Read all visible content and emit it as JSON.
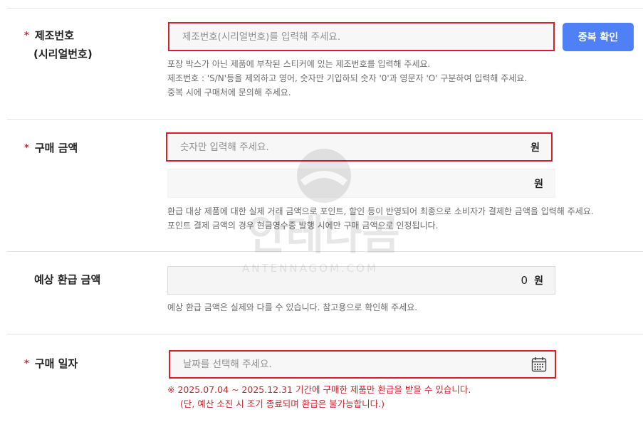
{
  "serial": {
    "label_line1": "제조번호",
    "label_line2": "(시리얼번호)",
    "placeholder": "제조번호(시리얼번호)를 입력해 주세요.",
    "check_button": "중복 확인",
    "help": [
      "포장 박스가 아닌 제품에 부착된 스티커에 있는 제조번호를 입력해 주세요.",
      "제조번호 : 'S/N'등을 제외하고 영어, 숫자만 기입하되 숫자 '0'과 영문자 'O' 구분하여 입력해 주세요.",
      "중복 시에 구매처에 문의해 주세요."
    ]
  },
  "purchase_amount": {
    "label": "구매 금액",
    "placeholder": "숫자만 입력해 주세요.",
    "unit": "원",
    "second_unit": "원",
    "help": [
      "환급 대상 제품에 대한 실제 거래 금액으로 포인트, 할인 등이 반영되어 최종으로 소비자가 결제한 금액을 입력해 주세요.",
      "포인트 결제 금액의 경우 현금영수증 발행 시에만 구매 금액으로 인정됩니다."
    ]
  },
  "expected_refund": {
    "label": "예상 환급 금액",
    "value": "0",
    "unit": "원",
    "help": "예상 환급 금액은 실제와 다를 수 있습니다. 참고용으로 확인해 주세요."
  },
  "purchase_date": {
    "label": "구매 일자",
    "placeholder": "날짜를 선택해 주세요.",
    "icon": "calendar-icon",
    "warning": [
      "※ 2025.07.04 ~ 2025.12.31 기간에 구매한 제품만 환급을 받을 수 있습니다.",
      "(단, 예산 소진 시 조기 종료되며 환급은 불가능합니다.)"
    ]
  },
  "required_mark": "*",
  "watermark": {
    "brand": "안테나곰",
    "domain": "ANTENNAGOM.COM"
  },
  "colors": {
    "accent": "#4f80f5",
    "error_border": "#d8202c",
    "warning_text": "#c8252c",
    "required": "#e0202c"
  }
}
